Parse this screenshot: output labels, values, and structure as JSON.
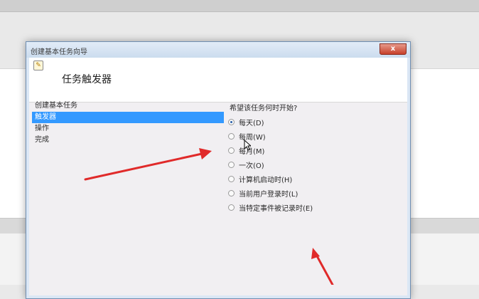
{
  "window": {
    "title": "创建基本任务向导",
    "close_label": "x"
  },
  "header": {
    "icon": "wizard-icon",
    "title": "任务触发器"
  },
  "steps": [
    {
      "label": "创建基本任务",
      "active": false
    },
    {
      "label": "触发器",
      "active": true
    },
    {
      "label": "操作",
      "active": false
    },
    {
      "label": "完成",
      "active": false
    }
  ],
  "trigger": {
    "question": "希望该任务何时开始?",
    "options": [
      {
        "label": "每天(D)",
        "checked": true
      },
      {
        "label": "每周(W)",
        "checked": false
      },
      {
        "label": "每月(M)",
        "checked": false
      },
      {
        "label": "一次(O)",
        "checked": false
      },
      {
        "label": "计算机启动时(H)",
        "checked": false
      },
      {
        "label": "当前用户登录时(L)",
        "checked": false
      },
      {
        "label": "当特定事件被记录时(E)",
        "checked": false
      }
    ]
  },
  "colors": {
    "selection": "#3399ff",
    "annotation_arrow": "#e02a2a",
    "title_bar": "#cbdcee"
  },
  "annotations": [
    "red-arrow",
    "red-arrow"
  ]
}
